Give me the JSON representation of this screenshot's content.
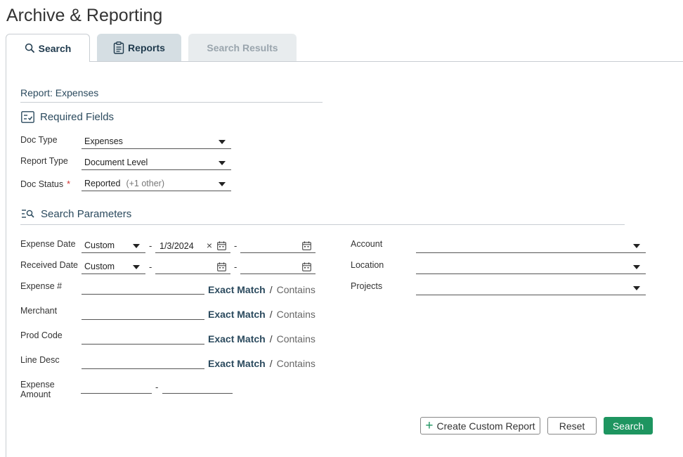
{
  "page_title": "Archive & Reporting",
  "tabs": {
    "search": "Search",
    "reports": "Reports",
    "results": "Search Results"
  },
  "report_title": "Report: Expenses",
  "required": {
    "heading": "Required Fields",
    "doc_type": {
      "label": "Doc Type",
      "value": "Expenses"
    },
    "report_type": {
      "label": "Report Type",
      "value": "Document Level"
    },
    "doc_status": {
      "label": "Doc Status",
      "required_mark": "*",
      "value": "Reported",
      "extra": "(+1 other)"
    }
  },
  "params": {
    "heading": "Search Parameters",
    "expense_date": {
      "label": "Expense Date",
      "mode": "Custom",
      "from": "1/3/2024",
      "to": ""
    },
    "received_date": {
      "label": "Received Date",
      "mode": "Custom",
      "from": "",
      "to": ""
    },
    "dash": "-",
    "expense_no": {
      "label": "Expense #",
      "value": ""
    },
    "merchant": {
      "label": "Merchant",
      "value": ""
    },
    "prod_code": {
      "label": "Prod Code",
      "value": ""
    },
    "line_desc": {
      "label": "Line Desc",
      "value": ""
    },
    "expense_amount": {
      "label_1": "Expense",
      "label_2": "Amount",
      "from": "",
      "to": ""
    },
    "exact_match": "Exact Match",
    "slash": "/",
    "contains": "Contains",
    "account": {
      "label": "Account",
      "value": ""
    },
    "location": {
      "label": "Location",
      "value": ""
    },
    "projects": {
      "label": "Projects",
      "value": ""
    }
  },
  "buttons": {
    "create_custom_report": "Create Custom Report",
    "reset": "Reset",
    "search": "Search"
  },
  "colors": {
    "accent_green": "#1e9560",
    "heading_blue": "#2b4a5e",
    "required_red": "#d03030"
  }
}
